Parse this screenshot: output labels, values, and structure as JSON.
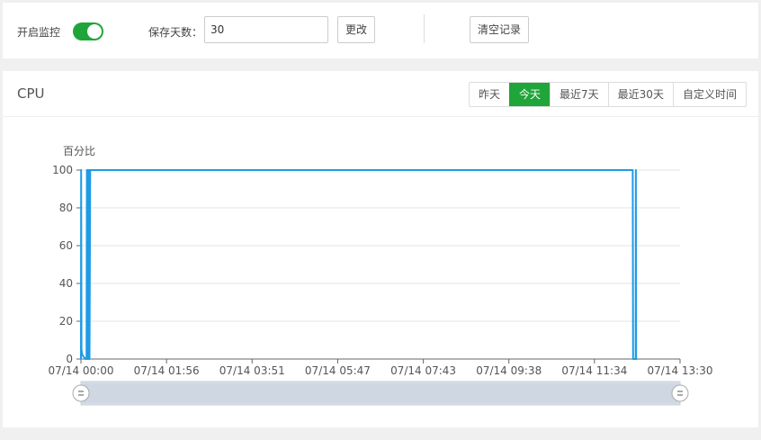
{
  "settings": {
    "monitor_label": "开启监控",
    "monitor_enabled": true,
    "days_label": "保存天数：",
    "days_value": "30",
    "change_button": "更改",
    "clear_button": "清空记录"
  },
  "panel": {
    "title": "CPU",
    "range_tabs": [
      "昨天",
      "今天",
      "最近7天",
      "最近30天",
      "自定义时间"
    ],
    "active_tab": "今天",
    "accent_color": "#20a53a"
  },
  "chart_data": {
    "type": "line",
    "ylabel": "百分比",
    "ylim": [
      0,
      100
    ],
    "yticks": [
      0,
      20,
      40,
      60,
      80,
      100
    ],
    "x_tick_labels": [
      "07/14 00:00",
      "07/14 01:56",
      "07/14 03:51",
      "07/14 05:47",
      "07/14 07:43",
      "07/14 09:38",
      "07/14 11:34",
      "07/14 13:30"
    ],
    "x_unit": "minutes since 07/14 00:00",
    "x_range": [
      0,
      810
    ],
    "line_color": "#1e9be6",
    "grid": "horizontal",
    "series": [
      {
        "name": "",
        "points": [
          [
            0,
            0
          ],
          [
            0.3,
            100
          ],
          [
            0.7,
            5
          ],
          [
            2,
            2
          ],
          [
            4,
            1
          ],
          [
            6,
            0
          ],
          [
            7.5,
            0
          ],
          [
            8,
            100
          ],
          [
            8.5,
            0
          ],
          [
            9,
            100
          ],
          [
            9.5,
            0
          ],
          [
            10,
            100
          ],
          [
            10.5,
            0
          ],
          [
            11,
            100
          ],
          [
            11.5,
            0
          ],
          [
            12.5,
            100
          ],
          [
            746,
            100
          ],
          [
            746.5,
            0
          ],
          [
            750,
            0
          ],
          [
            750.3,
            100
          ],
          [
            750.7,
            0
          ],
          [
            752,
            0
          ]
        ]
      }
    ],
    "data_zoom": {
      "start": 0,
      "end": 100
    }
  }
}
